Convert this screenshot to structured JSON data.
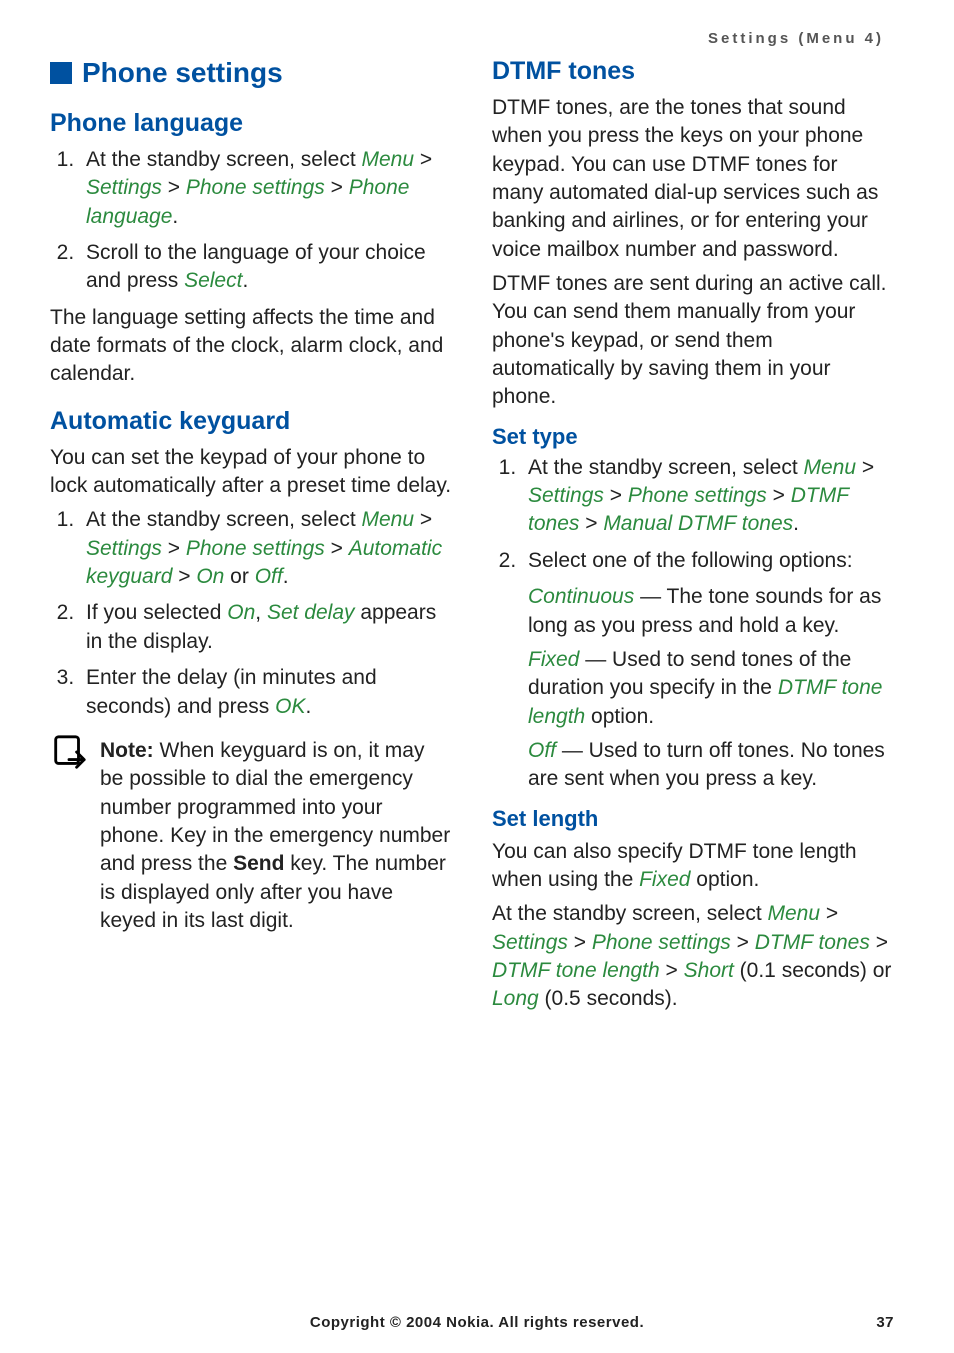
{
  "header": "Settings (Menu 4)",
  "left": {
    "section_title": "Phone settings",
    "s1": {
      "title": "Phone language",
      "li1_a": "At the standby screen, select ",
      "li1_b": "Menu",
      "li1_c": " > ",
      "li1_d": "Settings",
      "li1_e": " > ",
      "li1_f": "Phone settings",
      "li1_g": " > ",
      "li1_h": "Phone language",
      "li1_i": ".",
      "li2_a": "Scroll to the language of your choice and press ",
      "li2_b": "Select",
      "li2_c": ".",
      "p1": "The language setting affects the time and date formats of the clock, alarm clock, and calendar."
    },
    "s2": {
      "title": "Automatic keyguard",
      "p1": "You can set the keypad of your phone to lock automatically after a preset time delay.",
      "li1_a": "At the standby screen, select ",
      "li1_b": "Menu",
      "li1_c": " > ",
      "li1_d": "Settings",
      "li1_e": " > ",
      "li1_f": "Phone settings",
      "li1_g": " > ",
      "li1_h": "Automatic keyguard",
      "li1_i": " > ",
      "li1_j": "On",
      "li1_k": " or ",
      "li1_l": "Off",
      "li1_m": ".",
      "li2_a": "If you selected ",
      "li2_b": "On",
      "li2_c": ", ",
      "li2_d": "Set delay",
      "li2_e": " appears in the display.",
      "li3_a": "Enter the delay (in minutes and seconds) and press ",
      "li3_b": "OK",
      "li3_c": ".",
      "note_label": "Note:",
      "note_a": " When keyguard is on, it may be possible to dial the emergency number programmed into your phone. Key in the emergency number and press the ",
      "note_b": "Send",
      "note_c": " key. The number is displayed only after you have keyed in its last digit."
    }
  },
  "right": {
    "s3": {
      "title": "DTMF tones",
      "p1": "DTMF tones, are the tones that sound when you press the keys on your phone keypad. You can use DTMF tones for many automated dial-up services such as banking and airlines, or for entering your voice mailbox number and password.",
      "p2": "DTMF tones are sent during an active call. You can send them manually from your phone's keypad, or send them automatically by saving them in your phone."
    },
    "s4": {
      "title": "Set type",
      "li1_a": "At the standby screen, select ",
      "li1_b": "Menu",
      "li1_c": " > ",
      "li1_d": "Settings",
      "li1_e": " > ",
      "li1_f": "Phone settings",
      "li1_g": " > ",
      "li1_h": "DTMF tones",
      "li1_i": " > ",
      "li1_j": "Manual DTMF tones",
      "li1_k": ".",
      "li2": "Select one of the following options:",
      "opt1_a": "Continuous",
      "opt1_b": " — The tone sounds for as long as you press and hold a key.",
      "opt2_a": "Fixed",
      "opt2_b": " — Used to send tones of the duration you specify in the ",
      "opt2_c": "DTMF tone length",
      "opt2_d": " option.",
      "opt3_a": "Off",
      "opt3_b": " — Used to turn off tones. No tones are sent when you press a key."
    },
    "s5": {
      "title": "Set length",
      "p1_a": "You can also specify DTMF tone length when using the ",
      "p1_b": "Fixed",
      "p1_c": " option.",
      "p2_a": "At the standby screen, select ",
      "p2_b": "Menu",
      "p2_c": " > ",
      "p2_d": "Settings",
      "p2_e": " > ",
      "p2_f": "Phone settings",
      "p2_g": " > ",
      "p2_h": "DTMF tones",
      "p2_i": " > ",
      "p2_j": "DTMF tone length",
      "p2_k": " > ",
      "p2_l": "Short",
      "p2_m": " (0.1 seconds) or ",
      "p2_n": "Long",
      "p2_o": " (0.5 seconds)."
    }
  },
  "footer": {
    "copyright": "Copyright © 2004 Nokia. All rights reserved.",
    "page": "37"
  }
}
